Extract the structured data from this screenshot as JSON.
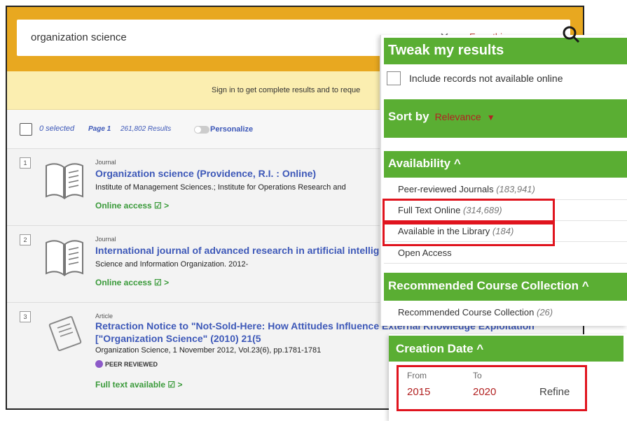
{
  "search": {
    "query": "organization science",
    "clear_symbol": "×",
    "scope": "Everything"
  },
  "signin": {
    "text": "Sign in to get complete results and to reque"
  },
  "toolbar": {
    "selected": "0 selected",
    "page": "Page 1",
    "results": "261,802 Results",
    "personalize": "Personalize"
  },
  "results": [
    {
      "num": "1",
      "type": "Journal",
      "title": "Organization science (Providence, R.I. : Online)",
      "subtitle": "Institute of Management Sciences.; Institute for Operations Research and",
      "access": "Online access ☑ >"
    },
    {
      "num": "2",
      "type": "Journal",
      "title": "International journal of advanced research in artificial intellig",
      "subtitle": "Science and Information Organization. 2012-",
      "access": "Online access ☑ >"
    },
    {
      "num": "3",
      "type": "Article",
      "title": "Retraction Notice to \"Not-Sold-Here: How Attitudes Influence External Knowledge Exploitation\" [\"Organization Science\" (2010) 21(5",
      "subtitle": "Organization Science, 1 November 2012, Vol.23(6), pp.1781-1781",
      "badge": "PEER REVIEWED",
      "access": "Full text available ☑ >"
    }
  ],
  "panel": {
    "tweak_title": "Tweak my results",
    "include_label": "Include records not available online",
    "sort_label": "Sort by",
    "sort_value": "Relevance",
    "sort_caret": "▼",
    "availability_title": "Availability ^",
    "facets": [
      {
        "label": "Peer-reviewed Journals",
        "count": "(183,941)"
      },
      {
        "label": "Full Text Online",
        "count": "(314,689)"
      },
      {
        "label": "Available in the Library",
        "count": "(184)"
      },
      {
        "label": "Open Access",
        "count": ""
      }
    ],
    "rec_title": "Recommended Course Collection ^",
    "rec_item": {
      "label": "Recommended Course Collection",
      "count": "(26)"
    }
  },
  "creation": {
    "title": "Creation Date ^",
    "from_label": "From",
    "to_label": "To",
    "from_value": "2015",
    "to_value": "2020",
    "refine": "Refine"
  },
  "colors": {
    "accent_green": "#5aae33",
    "highlight_red": "#e0141e",
    "brand_yellow": "#e8a820",
    "link_blue": "#3d58b8"
  }
}
